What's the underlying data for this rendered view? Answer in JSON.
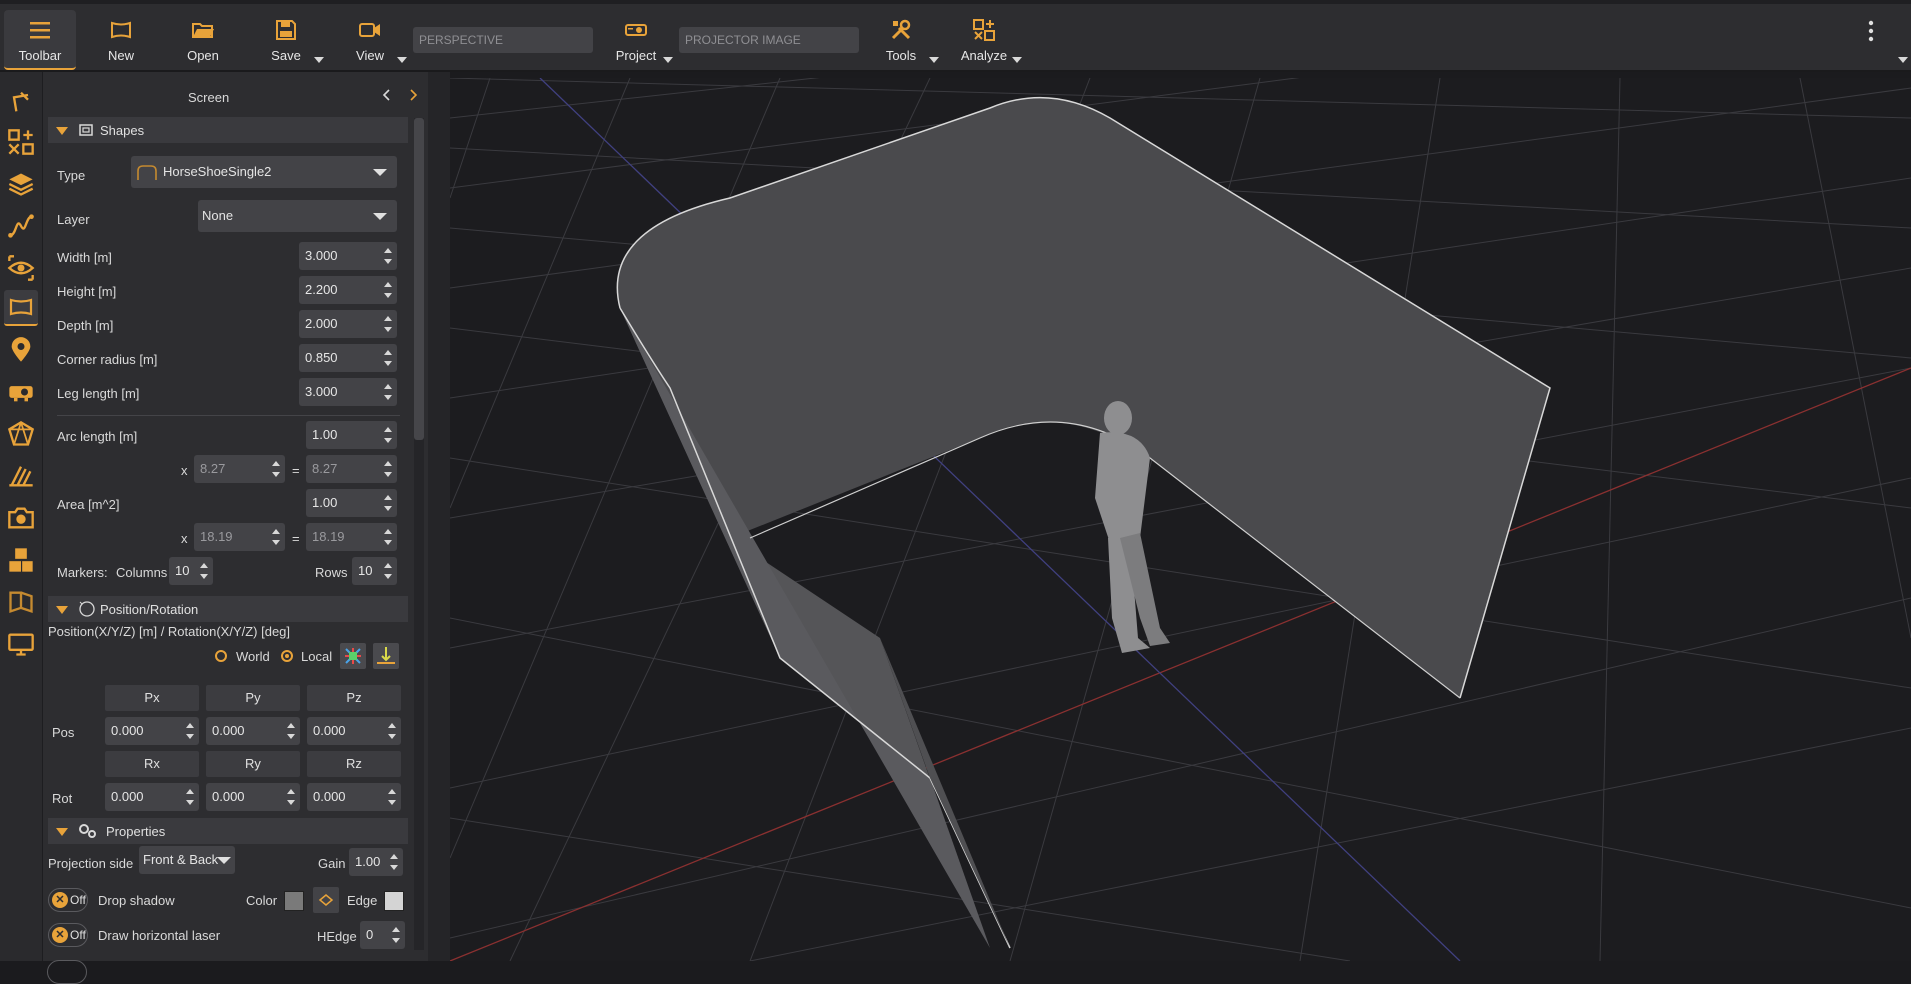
{
  "toolbar": {
    "items": [
      {
        "label": "Toolbar",
        "icon": "hamburger-icon"
      },
      {
        "label": "New",
        "icon": "screen-new-icon"
      },
      {
        "label": "Open",
        "icon": "folder-open-icon"
      },
      {
        "label": "Save",
        "icon": "save-icon"
      },
      {
        "label": "View",
        "icon": "camera-view-icon"
      },
      {
        "label": "Project",
        "icon": "projector-icon"
      },
      {
        "label": "Tools",
        "icon": "tools-icon"
      },
      {
        "label": "Analyze",
        "icon": "analyze-icon"
      }
    ],
    "perspective_placeholder": "PERSPECTIVE",
    "projector_placeholder": "PROJECTOR IMAGE"
  },
  "panel": {
    "title": "Screen",
    "shapes_section": "Shapes",
    "type_label": "Type",
    "type_value": "HorseShoeSingle2",
    "layer_label": "Layer",
    "layer_value": "None",
    "fields": [
      {
        "label": "Width  [m]",
        "value": "3.000"
      },
      {
        "label": "Height  [m]",
        "value": "2.200"
      },
      {
        "label": "Depth  [m]",
        "value": "2.000"
      },
      {
        "label": "Corner radius  [m]",
        "value": "0.850"
      },
      {
        "label": "Leg length  [m]",
        "value": "3.000"
      }
    ],
    "arc_label": "Arc length  [m]",
    "arc_value": "1.00",
    "arc_x": "8.27",
    "arc_result": "8.27",
    "area_label": "Area  [m^2]",
    "area_value": "1.00",
    "area_x": "18.19",
    "area_result": "18.19",
    "x_sign": "x",
    "eq_sign": "=",
    "markers_label": "Markers:",
    "columns_label": "Columns",
    "columns_value": "10",
    "rows_label": "Rows",
    "rows_value": "10",
    "pos_section": "Position/Rotation",
    "pos_caption": "Position(X/Y/Z) [m] / Rotation(X/Y/Z) [deg]",
    "world_label": "World",
    "local_label": "Local",
    "pos_headers": [
      "Px",
      "Py",
      "Pz"
    ],
    "rot_headers": [
      "Rx",
      "Ry",
      "Rz"
    ],
    "pos_label": "Pos",
    "rot_label": "Rot",
    "pos_values": [
      "0.000",
      "0.000",
      "0.000"
    ],
    "rot_values": [
      "0.000",
      "0.000",
      "0.000"
    ],
    "props_section": "Properties",
    "proj_side_label": "Projection side",
    "proj_side_value": "Front & Back",
    "gain_label": "Gain",
    "gain_value": "1.00",
    "off_label": "Off",
    "drop_shadow_label": "Drop shadow",
    "color_label": "Color",
    "edge_label": "Edge",
    "hlaser_label": "Draw horizontal laser",
    "hedge_label": "HEdge",
    "hedge_value": "0"
  },
  "colors": {
    "accent": "#e8a33a",
    "panel": "#2d2d30",
    "viewport": "#1c1c1f"
  }
}
